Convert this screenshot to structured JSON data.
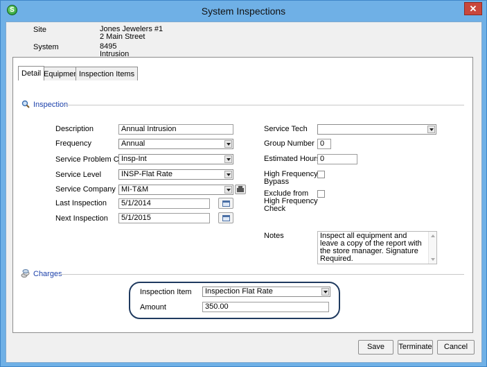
{
  "window": {
    "title": "System Inspections",
    "app_icon_glyph": "S",
    "close_glyph": "✕"
  },
  "header": {
    "site_label": "Site",
    "site_name": "Jones Jewelers #1",
    "site_address": "2 Main Street",
    "system_label": "System",
    "system_number": "8495",
    "system_type": "Intrusion"
  },
  "tabs": [
    {
      "label": "Detail",
      "active": true
    },
    {
      "label": "Equipment",
      "active": false
    },
    {
      "label": "Inspection Items",
      "active": false
    }
  ],
  "inspection": {
    "section_title": "Inspection",
    "description": {
      "label": "Description",
      "value": "Annual Intrusion"
    },
    "frequency": {
      "label": "Frequency",
      "value": "Annual"
    },
    "service_problem_code": {
      "label": "Service Problem Code",
      "value": "Insp-Int"
    },
    "service_level": {
      "label": "Service Level",
      "value": "INSP-Flat Rate"
    },
    "service_company": {
      "label": "Service Company",
      "value": "MI-T&M"
    },
    "last_inspection": {
      "label": "Last Inspection",
      "value": "5/1/2014"
    },
    "next_inspection": {
      "label": "Next Inspection",
      "value": "5/1/2015"
    },
    "service_tech": {
      "label": "Service Tech",
      "value": ""
    },
    "group_number": {
      "label": "Group Number",
      "value": "0"
    },
    "estimated_hours": {
      "label": "Estimated Hours",
      "value": "0"
    },
    "high_frequency_bypass": {
      "label_line1": "High Frequency",
      "label_line2": "Bypass",
      "checked": false
    },
    "exclude_high_frequency": {
      "label_line1": "Exclude from",
      "label_line2": "High Frequency",
      "label_line3": "Check",
      "checked": false
    },
    "notes": {
      "label": "Notes",
      "value": "Inspect all equipment and leave a copy of the report with the store manager. Signature Required."
    }
  },
  "charges": {
    "section_title": "Charges",
    "inspection_item": {
      "label": "Inspection Item",
      "value": "Inspection Flat Rate"
    },
    "amount": {
      "label": "Amount",
      "value": "350.00"
    }
  },
  "buttons": {
    "save": "Save",
    "terminate": "Terminate",
    "cancel": "Cancel"
  },
  "icons": {
    "app": "app-logo-icon",
    "close": "close-icon",
    "inspection": "magnifier-icon",
    "charges": "coins-icon",
    "calendar": "calendar-icon",
    "company_lookup": "company-lookup-icon"
  },
  "colors": {
    "title_bar": "#6fb0e6",
    "section_title": "#1a3faa",
    "highlight_ring": "#1f3a5f"
  }
}
